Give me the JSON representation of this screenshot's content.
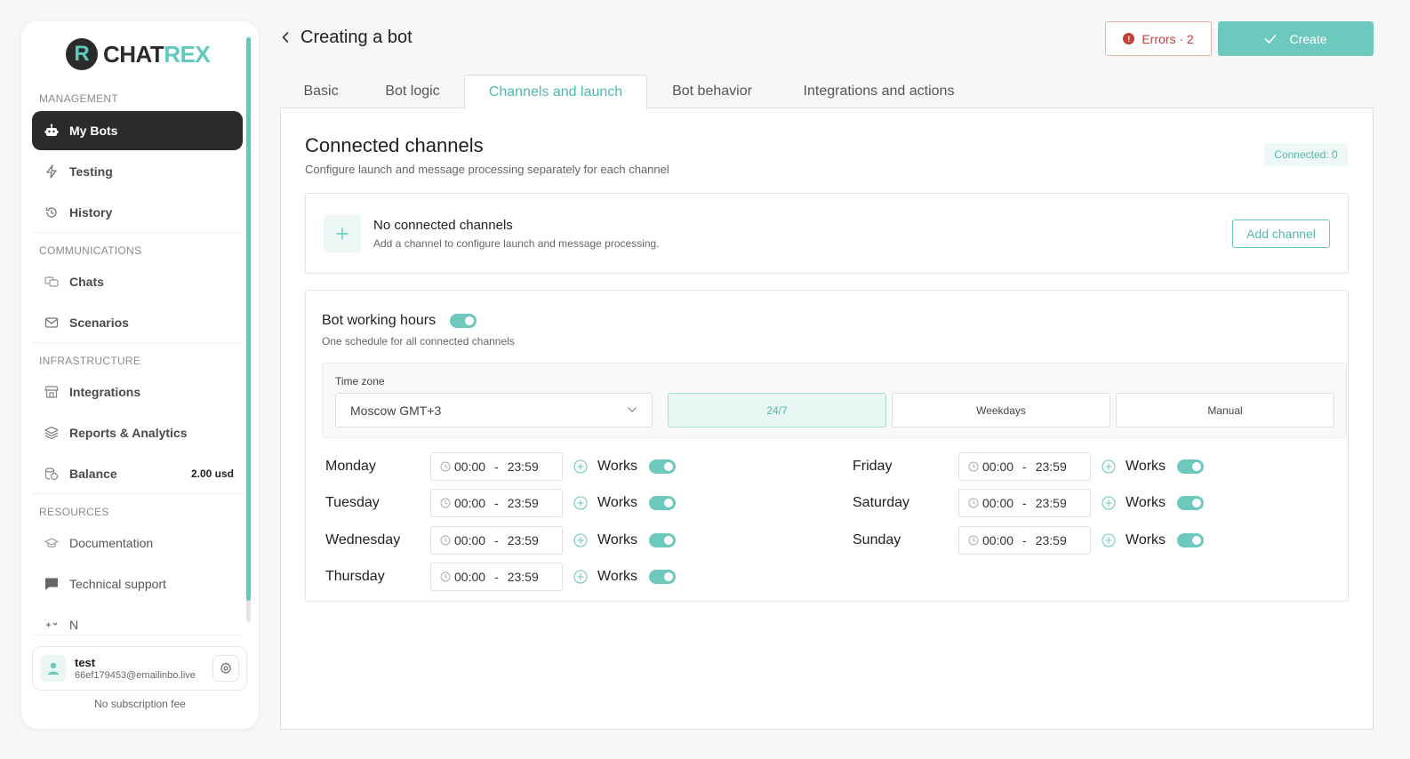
{
  "logo": {
    "mark": "R",
    "text_a": "CHAT",
    "text_b": "REX"
  },
  "sidebar": {
    "sections": [
      {
        "label": "MANAGEMENT"
      },
      {
        "label": "COMMUNICATIONS"
      },
      {
        "label": "INFRASTRUCTURE"
      },
      {
        "label": "RESOURCES"
      }
    ],
    "items": [
      {
        "label": "My Bots",
        "icon": "robot-icon"
      },
      {
        "label": "Testing",
        "icon": "lightning-icon"
      },
      {
        "label": "History",
        "icon": "history-icon"
      },
      {
        "label": "Chats",
        "icon": "chats-icon"
      },
      {
        "label": "Scenarios",
        "icon": "envelope-icon"
      },
      {
        "label": "Integrations",
        "icon": "store-icon"
      },
      {
        "label": "Reports & Analytics",
        "icon": "layers-icon"
      },
      {
        "label": "Balance",
        "icon": "coins-icon",
        "extra": "2.00 usd"
      },
      {
        "label": "Documentation",
        "icon": "graduation-cap-icon"
      },
      {
        "label": "Technical support",
        "icon": "message-icon"
      },
      {
        "label": "N",
        "icon": "news-icon"
      }
    ],
    "user": {
      "name": "test",
      "email": "66ef179453@emailinbo.live"
    },
    "subscription": "No subscription fee"
  },
  "header": {
    "title": "Creating a bot",
    "errors_label": "Errors · 2",
    "create_label": "Create"
  },
  "tabs": [
    {
      "label": "Basic"
    },
    {
      "label": "Bot logic"
    },
    {
      "label": "Channels and launch",
      "active": true
    },
    {
      "label": "Bot behavior"
    },
    {
      "label": "Integrations and actions"
    }
  ],
  "channels": {
    "title": "Connected channels",
    "subtitle": "Configure launch and message processing separately for each channel",
    "badge": "Connected: 0",
    "empty_title": "No connected channels",
    "empty_subtitle": "Add a channel to configure launch and message processing.",
    "add_button": "Add channel"
  },
  "working_hours": {
    "title": "Bot working hours",
    "subtitle": "One schedule for all connected channels",
    "enabled": true,
    "timezone_label": "Time zone",
    "timezone_value": "Moscow GMT+3",
    "modes": [
      {
        "label": "24/7",
        "active": true
      },
      {
        "label": "Weekdays"
      },
      {
        "label": "Manual"
      }
    ],
    "days": [
      {
        "day": "Monday",
        "from": "00:00",
        "to": "23:59",
        "status": "Works",
        "on": true
      },
      {
        "day": "Tuesday",
        "from": "00:00",
        "to": "23:59",
        "status": "Works",
        "on": true
      },
      {
        "day": "Wednesday",
        "from": "00:00",
        "to": "23:59",
        "status": "Works",
        "on": true
      },
      {
        "day": "Thursday",
        "from": "00:00",
        "to": "23:59",
        "status": "Works",
        "on": true
      },
      {
        "day": "Friday",
        "from": "00:00",
        "to": "23:59",
        "status": "Works",
        "on": true
      },
      {
        "day": "Saturday",
        "from": "00:00",
        "to": "23:59",
        "status": "Works",
        "on": true
      },
      {
        "day": "Sunday",
        "from": "00:00",
        "to": "23:59",
        "status": "Works",
        "on": true
      }
    ],
    "time_separator": "-"
  },
  "colors": {
    "accent": "#6dc8bd",
    "dark": "#2b2b2b",
    "error": "#c0413a"
  }
}
